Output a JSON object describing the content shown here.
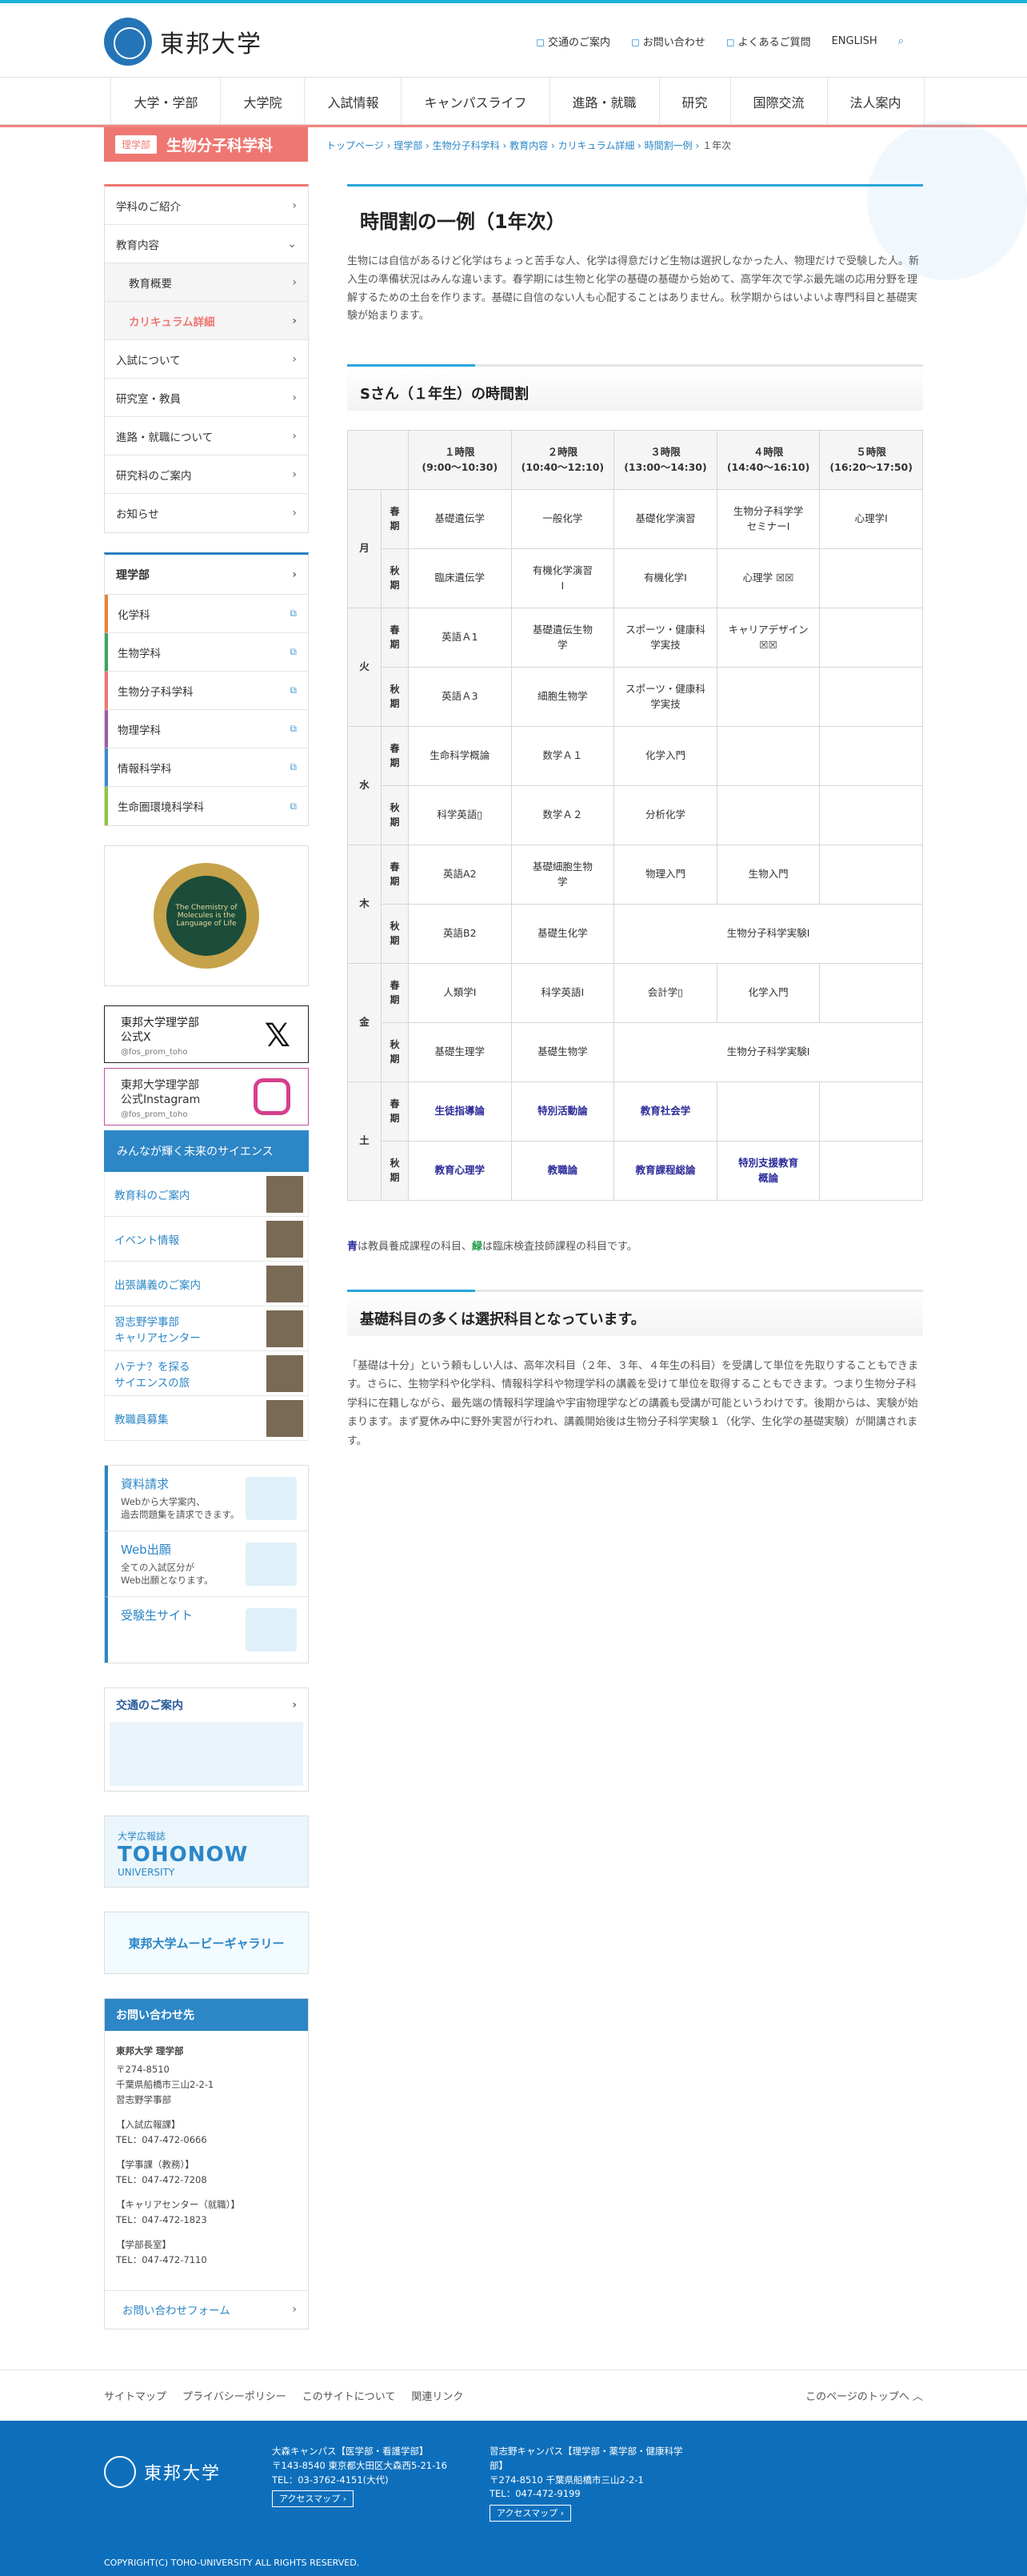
{
  "header": {
    "logo_text": "東邦大学",
    "utils": [
      {
        "icon": "bus-icon",
        "label": "交通のご案内"
      },
      {
        "icon": "mail-icon",
        "label": "お問い合わせ"
      },
      {
        "icon": "question-icon",
        "label": "よくあるご質問"
      },
      {
        "icon": "",
        "label": "ENGLISH"
      }
    ]
  },
  "gnav": [
    "大学・学部",
    "大学院",
    "入試情報",
    "キャンパスライフ",
    "進路・就職",
    "研究",
    "国際交流",
    "法人案内"
  ],
  "dept": {
    "tag": "理学部",
    "name": "生物分子科学科"
  },
  "breadcrumb": {
    "items": [
      "トップページ",
      "理学部",
      "生物分子科学科",
      "教育内容",
      "カリキュラム詳細",
      "時間割一例"
    ],
    "current": "１年次"
  },
  "sidenav": [
    {
      "label": "学科のご紹介",
      "cls": ""
    },
    {
      "label": "教育内容",
      "cls": "open"
    },
    {
      "label": "教育概要",
      "cls": "sub"
    },
    {
      "label": "カリキュラム詳細",
      "cls": "sub active"
    },
    {
      "label": "入試について",
      "cls": ""
    },
    {
      "label": "研究室・教員",
      "cls": ""
    },
    {
      "label": "進路・就職について",
      "cls": ""
    },
    {
      "label": "研究科のご案内",
      "cls": ""
    },
    {
      "label": "お知らせ",
      "cls": ""
    }
  ],
  "faculty": {
    "title": "理学部",
    "items": [
      {
        "label": "化学科",
        "color": "#e8843a"
      },
      {
        "label": "生物学科",
        "color": "#3aa55a"
      },
      {
        "label": "生物分子科学科",
        "color": "#ee7772"
      },
      {
        "label": "物理学科",
        "color": "#9a5bb0"
      },
      {
        "label": "情報科学科",
        "color": "#3a8ad0"
      },
      {
        "label": "生命圏環境科学科",
        "color": "#8cc63f"
      }
    ]
  },
  "emblem": {
    "text": "The Chemistry of Molecules is the Language of Life"
  },
  "sns": {
    "x_title": "東邦大学理学部\n公式X",
    "x_handle": "@fos_prom_toho",
    "ig_title": "東邦大学理学部\n公式Instagram",
    "ig_handle": "@fos_prom_toho"
  },
  "science_banner": "みんなが輝く未来のサイエンス",
  "side_links": [
    "教育科のご案内",
    "イベント情報",
    "出張講義のご案内",
    "習志野学事部\nキャリアセンター",
    "ハテナ？を探る\nサイエンスの旅",
    "教職員募集"
  ],
  "requests": [
    {
      "title": "資料請求",
      "desc": "Webから大学案内、\n過去問題集を請求できます。"
    },
    {
      "title": "Web出願",
      "desc": "全ての入試区分が\nWeb出願となります。"
    },
    {
      "title": "受験生サイト",
      "desc": ""
    }
  ],
  "access": {
    "title": "交通のご案内"
  },
  "toho_now": {
    "small": "大学広報誌",
    "big": "TOHONOW",
    "sub": "UNIVERSITY"
  },
  "movie": "東邦大学ムービーギャラリー",
  "contact": {
    "title": "お問い合わせ先",
    "org": "東邦大学 理学部",
    "address": "〒274-8510\n千葉県船橋市三山2-2-1\n習志野学事部",
    "blocks": [
      {
        "label": "【入試広報課】",
        "tel": "TEL：047-472-0666"
      },
      {
        "label": "【学事課（教務）】",
        "tel": "TEL：047-472-7208"
      },
      {
        "label": "【キャリアセンター（就職）】",
        "tel": "TEL：047-472-1823"
      },
      {
        "label": "【学部長室】",
        "tel": "TEL：047-472-7110"
      }
    ],
    "form": "お問い合わせフォーム"
  },
  "main": {
    "title": "時間割の一例（1年次）",
    "lead": "生物には自信があるけど化学はちょっと苦手な人、化学は得意だけど生物は選択しなかった人、物理だけで受験した人。新入生の準備状況はみんな違います。春学期には生物と化学の基礎の基礎から始めて、高学年次で学ぶ最先端の応用分野を理解するための土台を作ります。基礎に自信のない人も心配することはありません。秋学期からはいよいよ専門科目と基礎実験が始まります。",
    "section1": "Sさん（１年生）の時間割",
    "periods": [
      "１時限\n(9:00〜10:30)",
      "２時限\n(10:40〜12:10)",
      "３時限\n(13:00〜14:30)",
      "４時限\n(14:40〜16:10)",
      "５時限\n(16:20〜17:50)"
    ],
    "note_blue": "青",
    "note_mid": "は教員養成課程の科目、",
    "note_green": "緑",
    "note_end": "は臨床検査技師課程の科目です。",
    "section2": "基礎科目の多くは選択科目となっています。",
    "lead2": "「基礎は十分」という頼もしい人は、高年次科目（２年、３年、４年生の科目）を受講して単位を先取りすることもできます。さらに、生物学科や化学科、情報科学科や物理学科の講義を受けて単位を取得することもできます。つまり生物分子科学科に在籍しながら、最先端の情報科学理論や宇宙物理学などの講義も受講が可能というわけです。後期からは、実験が始まります。まず夏休み中に野外実習が行われ、講義開始後は生物分子科学実験１（化学、生化学の基礎実験）が開講されます。"
  },
  "timetable": [
    {
      "day": "月",
      "rows": [
        {
          "term": "春期",
          "cells": [
            {
              "t": "基礎遺伝学"
            },
            {
              "t": "一般化学"
            },
            {
              "t": "基礎化学演習"
            },
            {
              "t": "生物分子科学学\nセミナーⅠ"
            },
            {
              "t": "心理学Ⅰ"
            }
          ]
        },
        {
          "term": "秋期",
          "cells": [
            {
              "t": "臨床遺伝学"
            },
            {
              "t": "有機化学演習\nⅠ"
            },
            {
              "t": "有機化学Ⅰ"
            },
            {
              "t": "心理学 ☒☒"
            },
            {
              "t": ""
            }
          ]
        }
      ]
    },
    {
      "day": "火",
      "rows": [
        {
          "term": "春期",
          "cells": [
            {
              "t": "英語Ａ1"
            },
            {
              "t": "基礎遺伝生物\n学"
            },
            {
              "t": "スポーツ・健康科\n学実技"
            },
            {
              "t": "キャリアデザイン\n☒☒"
            },
            {
              "t": ""
            }
          ]
        },
        {
          "term": "秋期",
          "cells": [
            {
              "t": "英語Ａ3"
            },
            {
              "t": "細胞生物学"
            },
            {
              "t": "スポーツ・健康科\n学実技"
            },
            {
              "t": ""
            },
            {
              "t": ""
            }
          ]
        }
      ]
    },
    {
      "day": "水",
      "rows": [
        {
          "term": "春期",
          "cells": [
            {
              "t": "生命科学概論"
            },
            {
              "t": "数学Ａ１"
            },
            {
              "t": "化学入門"
            },
            {
              "t": ""
            },
            {
              "t": ""
            }
          ]
        },
        {
          "term": "秋期",
          "cells": [
            {
              "t": "科学英語▯"
            },
            {
              "t": "数学Ａ２"
            },
            {
              "t": "分析化学"
            },
            {
              "t": ""
            },
            {
              "t": ""
            }
          ]
        }
      ]
    },
    {
      "day": "木",
      "rows": [
        {
          "term": "春期",
          "cells": [
            {
              "t": "英語A2"
            },
            {
              "t": "基礎細胞生物\n学"
            },
            {
              "t": "物理入門"
            },
            {
              "t": "生物入門"
            },
            {
              "t": ""
            }
          ]
        },
        {
          "term": "秋期",
          "cells": [
            {
              "t": "英語B2"
            },
            {
              "t": "基礎生化学"
            },
            {
              "t": "生物分子科学実験Ⅰ",
              "span": 3
            }
          ]
        }
      ]
    },
    {
      "day": "金",
      "rows": [
        {
          "term": "春期",
          "cells": [
            {
              "t": "人類学Ⅰ"
            },
            {
              "t": "科学英語Ⅰ"
            },
            {
              "t": "会計学▯"
            },
            {
              "t": "化学入門"
            },
            {
              "t": ""
            }
          ]
        },
        {
          "term": "秋期",
          "cells": [
            {
              "t": "基礎生理学"
            },
            {
              "t": "基礎生物学"
            },
            {
              "t": "生物分子科学実験Ⅰ",
              "span": 3
            }
          ]
        }
      ]
    },
    {
      "day": "土",
      "rows": [
        {
          "term": "春期",
          "cells": [
            {
              "t": "生徒指導論",
              "c": "blue"
            },
            {
              "t": "特別活動論",
              "c": "blue"
            },
            {
              "t": "教育社会学",
              "c": "blue"
            },
            {
              "t": ""
            },
            {
              "t": ""
            }
          ]
        },
        {
          "term": "秋期",
          "cells": [
            {
              "t": "教育心理学",
              "c": "blue"
            },
            {
              "t": "教職論",
              "c": "blue"
            },
            {
              "t": "教育課程総論",
              "c": "blue"
            },
            {
              "t": "特別支援教育\n概論",
              "c": "blue"
            },
            {
              "t": ""
            }
          ]
        }
      ]
    }
  ],
  "footer": {
    "links": [
      "サイトマップ",
      "プライバシーポリシー",
      "このサイトについて",
      "関連リンク"
    ],
    "totop": "このページのトップへ",
    "logo": "東邦大学",
    "campus1": "大森キャンパス【医学部・看護学部】\n〒143-8540 東京都大田区大森西5-21-16\nTEL：03-3762-4151(大代)",
    "campus2": "習志野キャンパス【理学部・薬学部・健康科学部】\n〒274-8510 千葉県船橋市三山2-2-1\nTEL：047-472-9199",
    "map_btn": "アクセスマップ ›",
    "copyright": "COPYRIGHT(C) TOHO-UNIVERSITY ALL RIGHTS RESERVED."
  }
}
